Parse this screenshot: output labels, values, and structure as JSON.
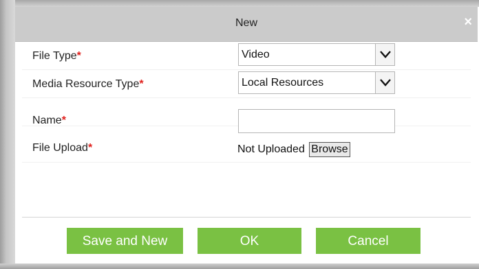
{
  "dialog": {
    "title": "New",
    "close_glyph": "×"
  },
  "form": {
    "required_mark": "*",
    "file_type": {
      "label": "File Type",
      "value": "Video"
    },
    "media_resource_type": {
      "label": "Media Resource Type",
      "value": "Local Resources"
    },
    "name": {
      "label": "Name",
      "value": ""
    },
    "file_upload": {
      "label": "File Upload",
      "status": "Not Uploaded",
      "browse_label": "Browse"
    }
  },
  "buttons": {
    "save_and_new": "Save and New",
    "ok": "OK",
    "cancel": "Cancel"
  },
  "colors": {
    "button_green": "#7ac143",
    "title_bar": "#cbcbcb",
    "required_red": "#e0201c"
  },
  "icons": {
    "close": "close-icon",
    "dropdown": "chevron-down-icon"
  }
}
